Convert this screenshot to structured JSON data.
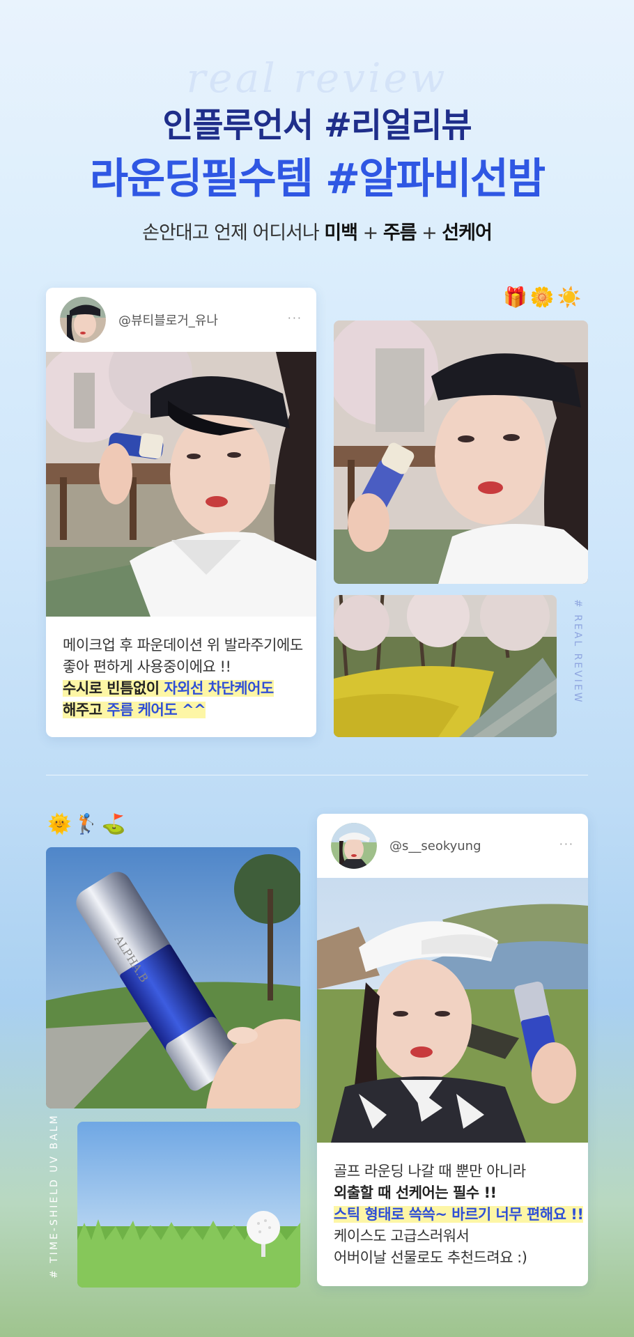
{
  "header": {
    "script_text": "real review",
    "title_line1": "인플루언서 #리얼리뷰",
    "title_line2": "라운딩필수템 #알파비선밤",
    "subtitle_prefix": "손안대고 언제 어디서나",
    "subtitle_kw1": "미백",
    "subtitle_plus1": " + ",
    "subtitle_kw2": "주름",
    "subtitle_plus2": " + ",
    "subtitle_kw3": "선케어"
  },
  "review1": {
    "handle": "@뷰티블로거_유나",
    "more": "···",
    "caption_line1": "메이크업 후 파운데이션 위 발라주기에도",
    "caption_line2": "좋아 편하게 사용중이에요 !!",
    "caption_line3_a": "수시로 빈틈없이 ",
    "caption_line3_b": "자외선 차단케어도",
    "caption_line4_a": "해주고 ",
    "caption_line4_b": "주름 케어도 ^^"
  },
  "side1": {
    "emojis": "🎁🌼☀️",
    "vertical_label": "# REAL REVIEW"
  },
  "review2": {
    "handle": "@s__seokyung",
    "more": "···",
    "caption_line1": "골프 라운딩 나갈 때 뿐만 아니라",
    "caption_line2": "외출할 때 선케어는 필수 !!",
    "caption_line3": "스틱 형태로 쓱쓱~ 바르기 너무 편해요 !!",
    "caption_line4": "케이스도 고급스러워서",
    "caption_line5": "어버이날 선물로도 추천드려요 :)"
  },
  "side2": {
    "emojis": "🌞🏌️⛳",
    "vertical_label": "# TIME-SHIELD UV BALM",
    "product_text": "ALPHA.B"
  },
  "colors": {
    "navy": "#1f2e8a",
    "blue": "#2f57e3",
    "highlight": "#fdf6a6"
  }
}
